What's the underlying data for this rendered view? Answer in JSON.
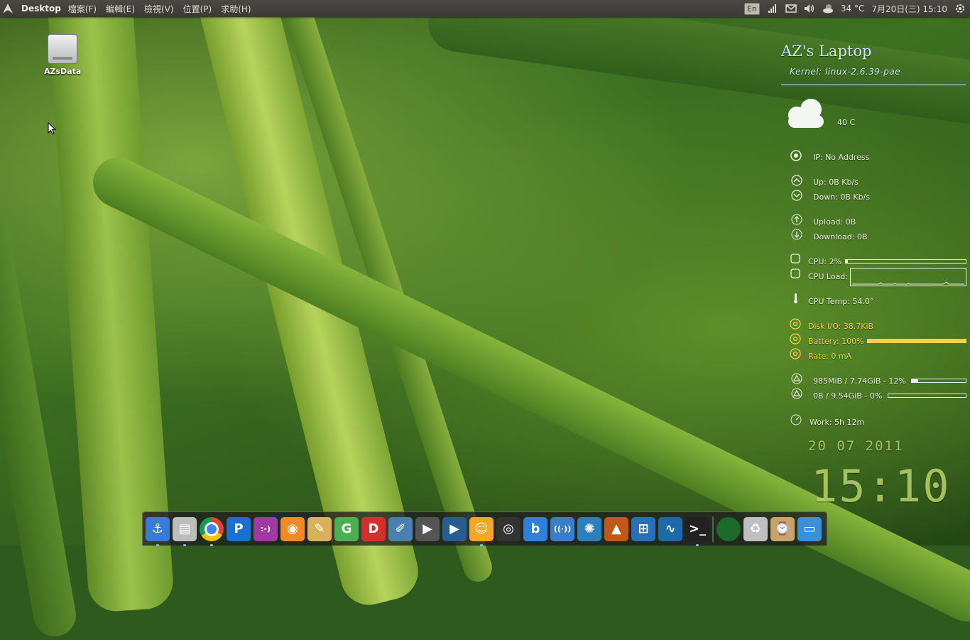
{
  "top_panel": {
    "app_title": "Desktop",
    "menus": [
      "檔案(F)",
      "編輯(E)",
      "檢視(V)",
      "位置(P)",
      "求助(H)"
    ],
    "keyboard_indicator": "En",
    "weather_temp": "34 °C",
    "datetime": "7月20日(三) 15:10"
  },
  "desktop": {
    "icons": [
      {
        "label": "AZsData",
        "icon": "drive-harddisk-icon"
      }
    ]
  },
  "conky": {
    "title": "AZ's Laptop",
    "kernel": "Kernel: linux-2.6.39-pae",
    "weather_temp": "40 C",
    "ip": "IP: No Address",
    "up_rate": "Up: 0B Kb/s",
    "down_rate": "Down: 0B Kb/s",
    "upload_total": "Upload: 0B",
    "download_total": "Download: 0B",
    "cpu": "CPU: 2%",
    "cpu_percent": 2,
    "cpu_load_label": "CPU Load:",
    "cpu_temp": "CPU Temp: 54.0°",
    "disk_io": "Disk I/O: 38.7KiB",
    "battery": "Battery: 100%",
    "battery_percent": 100,
    "rate": "Rate: 0 mA",
    "memory": "985MiB / 7.74GiB - 12%",
    "memory_percent": 12,
    "swap": "0B / 9.54GiB - 0%",
    "swap_percent": 0,
    "work": "Work:  5h 12m",
    "date_big": "20 07 2011",
    "time_big": "15:10"
  },
  "colors": {
    "conky_text": "#e9efe1",
    "conky_accent": "#cde6f5",
    "battery_yellow": "#f3d34a",
    "clock_green": "#b9d36a"
  },
  "dock": {
    "items": [
      {
        "name": "anchor-icon",
        "glyph": "⚓",
        "color": "#3a7bd5",
        "running": true
      },
      {
        "name": "file-manager-icon",
        "glyph": "▤",
        "color": "#bdbdbd",
        "running": true
      },
      {
        "name": "chrome-icon",
        "glyph": "",
        "color": "#e5e5e5",
        "running": true
      },
      {
        "name": "pidgin-p-icon",
        "glyph": "P",
        "color": "#1b6fd1",
        "running": false
      },
      {
        "name": "chat-emoticon-icon",
        "glyph": ":-)",
        "color": "#a13aa0",
        "running": false
      },
      {
        "name": "rss-feed-icon",
        "glyph": "◉",
        "color": "#f08a24",
        "running": false
      },
      {
        "name": "paint-palette-icon",
        "glyph": "✎",
        "color": "#d8b25a",
        "running": false
      },
      {
        "name": "grammar-g-icon",
        "glyph": "G",
        "color": "#4caf50",
        "running": false
      },
      {
        "name": "document-d-icon",
        "glyph": "D",
        "color": "#d32f2f",
        "running": false
      },
      {
        "name": "drawing-tools-icon",
        "glyph": "✐",
        "color": "#4a7fb0",
        "running": false
      },
      {
        "name": "media-player-icon",
        "glyph": "▶",
        "color": "#555555",
        "running": false
      },
      {
        "name": "video-editor-icon",
        "glyph": "▶",
        "color": "#2a5d8f",
        "running": false
      },
      {
        "name": "qq-penguin-icon",
        "glyph": "☺",
        "color": "#f5a623",
        "running": true
      },
      {
        "name": "camera-lens-icon",
        "glyph": "◎",
        "color": "#333333",
        "running": false
      },
      {
        "name": "bluetooth-b-icon",
        "glyph": "b",
        "color": "#2f80d8",
        "running": false
      },
      {
        "name": "wireless-icon",
        "glyph": "((·))",
        "color": "#3b7ec8",
        "running": false
      },
      {
        "name": "swirl-app-icon",
        "glyph": "✺",
        "color": "#2c7fbf",
        "running": false
      },
      {
        "name": "matlab-icon",
        "glyph": "▲",
        "color": "#c2571a",
        "running": false
      },
      {
        "name": "windows-logo-icon",
        "glyph": "⊞",
        "color": "#2d6fb5",
        "running": false
      },
      {
        "name": "system-monitor-icon",
        "glyph": "∿",
        "color": "#1e6aa8",
        "running": false
      },
      {
        "name": "terminal-icon",
        "glyph": ">_",
        "color": "#222222",
        "running": true
      }
    ],
    "tray": [
      {
        "name": "green-orb-icon",
        "glyph": "●",
        "color": "#1d6a2a"
      },
      {
        "name": "trash-icon",
        "glyph": "♻",
        "color": "#bfbfbf"
      },
      {
        "name": "recent-folder-icon",
        "glyph": "⌚",
        "color": "#c9a36b"
      },
      {
        "name": "desktop-folder-icon",
        "glyph": "▭",
        "color": "#3c8fd8"
      }
    ]
  }
}
